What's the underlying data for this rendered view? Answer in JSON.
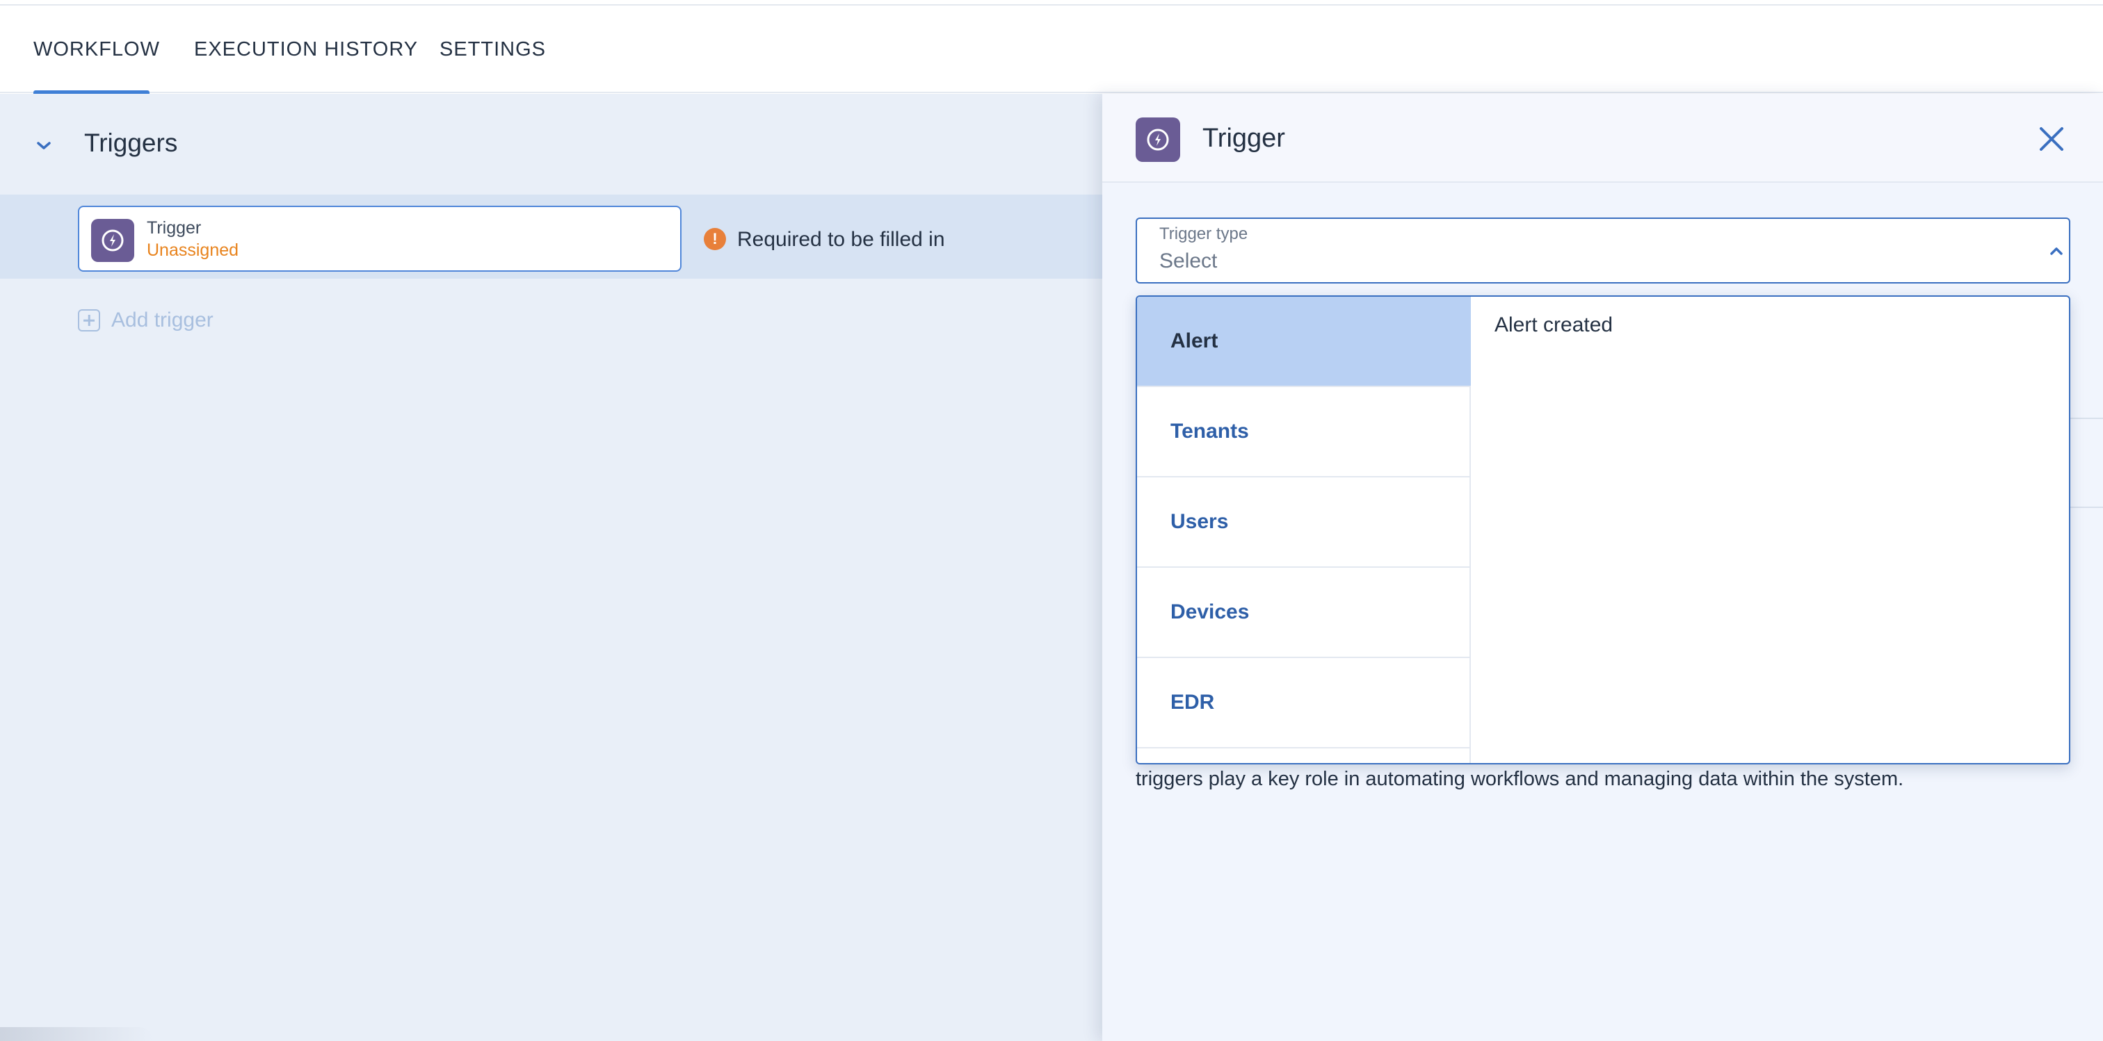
{
  "tabs": [
    {
      "label": "WORKFLOW",
      "active": true
    },
    {
      "label": "EXECUTION HISTORY",
      "active": false
    },
    {
      "label": "SETTINGS",
      "active": false
    }
  ],
  "triggers_section": {
    "title": "Triggers",
    "trigger_card": {
      "name": "Trigger",
      "status": "Unassigned",
      "icon": "trigger-icon"
    },
    "validation_message": "Required to be filled in",
    "add_trigger_label": "Add trigger"
  },
  "panel": {
    "title": "Trigger",
    "icon": "trigger-icon",
    "trigger_type": {
      "label": "Trigger type",
      "value": "Select"
    },
    "description_visible": "triggers play a key role in automating workflows and managing data within the system."
  },
  "dropdown": {
    "categories": [
      {
        "label": "Alert",
        "selected": true
      },
      {
        "label": "Tenants",
        "selected": false
      },
      {
        "label": "Users",
        "selected": false
      },
      {
        "label": "Devices",
        "selected": false
      },
      {
        "label": "EDR",
        "selected": false
      }
    ],
    "events": [
      {
        "label": "Alert created"
      }
    ]
  },
  "colors": {
    "accent": "#3f7fd6",
    "icon_bg": "#6a5c95",
    "warning": "#e8803a",
    "selected_bg": "#b8d0f3"
  }
}
